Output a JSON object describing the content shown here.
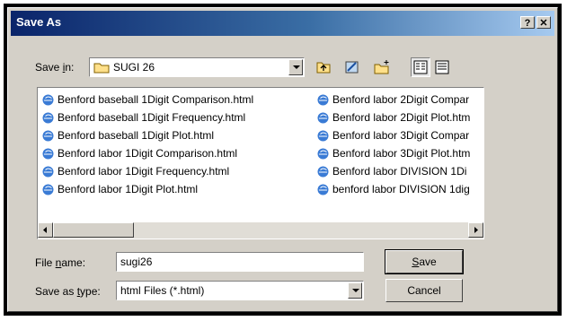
{
  "dialog": {
    "title": "Save As",
    "help_label": "?",
    "close_label": "✕"
  },
  "save_in": {
    "label_pre": "Save ",
    "label_key": "i",
    "label_post": "n:",
    "value": "SUGI 26"
  },
  "files": {
    "column1": [
      "Benford baseball 1Digit Comparison.html",
      "Benford baseball 1Digit Frequency.html",
      "Benford baseball 1Digit Plot.html",
      "Benford labor 1Digit Comparison.html",
      "Benford labor 1Digit Frequency.html",
      "Benford labor 1Digit Plot.html"
    ],
    "column2": [
      "Benford labor 2Digit Compar",
      "Benford labor 2Digit Plot.htm",
      "Benford labor 3Digit Compar",
      "Benford labor 3Digit Plot.htm",
      "Benford labor DIVISION 1Di",
      "benford labor DIVISION 1dig"
    ]
  },
  "file_name": {
    "label_pre": "File ",
    "label_key": "n",
    "label_post": "ame:",
    "value": "sugi26"
  },
  "save_type": {
    "label_pre": "Save as ",
    "label_key": "t",
    "label_post": "ype:",
    "value": "html Files (*.html)"
  },
  "buttons": {
    "save_key": "S",
    "save_rest": "ave",
    "cancel": "Cancel"
  },
  "colors": {
    "title_start": "#0a246a",
    "title_end": "#a6caf0",
    "face": "#d4d0c8"
  }
}
